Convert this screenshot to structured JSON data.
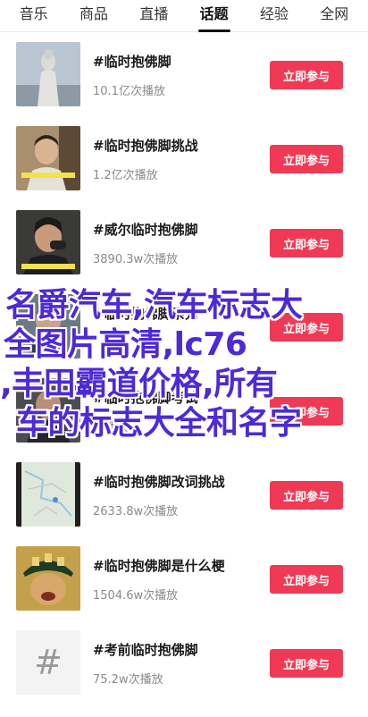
{
  "tabs": [
    {
      "label": "音乐",
      "active": false
    },
    {
      "label": "商品",
      "active": false
    },
    {
      "label": "直播",
      "active": false
    },
    {
      "label": "话题",
      "active": true
    },
    {
      "label": "经验",
      "active": false
    },
    {
      "label": "全网",
      "active": false
    }
  ],
  "join_label": "立即参与",
  "topics": [
    {
      "title": "#临时抱佛脚",
      "views": "10.1亿次播放"
    },
    {
      "title": "#临时抱佛脚挑战",
      "views": "1.2亿次播放"
    },
    {
      "title": "#威尔临时抱佛脚",
      "views": "3890.3w次播放"
    },
    {
      "title": "#临时抱佛脚系列",
      "views": ""
    },
    {
      "title": "#临时抱佛脚考试",
      "views": "次播放"
    },
    {
      "title": "#临时抱佛脚改词挑战",
      "views": "2633.8w次播放"
    },
    {
      "title": "#临时抱佛脚是什么梗",
      "views": "1504.6w次播放"
    },
    {
      "title": "#考前临时抱佛脚",
      "views": "75.2w次播放"
    }
  ],
  "hash_glyph": "#",
  "overlay": {
    "line1": "名爵汽车,汽车标志大",
    "line2": "全图片高清,lc76",
    "line3": ",丰田霸道价格,所有",
    "line4": "车的标志大全和名字"
  },
  "colors": {
    "accent": "#f03a55",
    "overlay_text": "#4d2ad6"
  }
}
